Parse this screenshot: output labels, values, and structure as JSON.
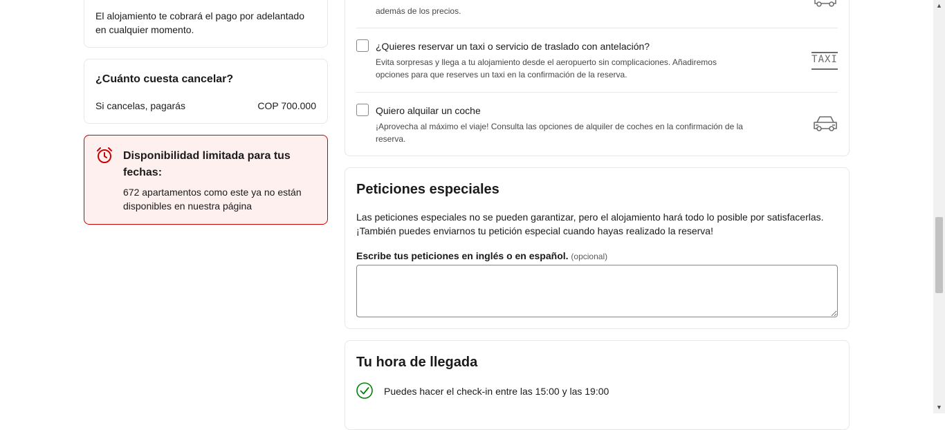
{
  "left": {
    "prepay_text": "El alojamiento te cobrará el pago por adelantado en cualquier momento.",
    "cancel": {
      "title": "¿Cuánto cuesta cancelar?",
      "label": "Si cancelas, pagarás",
      "amount": "COP 700.000"
    },
    "availability": {
      "title": "Disponibilidad limitada para tus fechas:",
      "text": "672 apartamentos como este ya no están disponibles en nuestra página",
      "icon": "alarm-clock-icon"
    }
  },
  "extras": {
    "top_partial_text": "además de los precios.",
    "items": [
      {
        "label": "¿Quieres reservar un taxi o servicio de traslado con antelación?",
        "desc": "Evita sorpresas y llega a tu alojamiento desde el aeropuerto sin complicaciones. Añadiremos opciones para que reserves un taxi en la confirmación de la reserva.",
        "icon": "taxi-icon",
        "icon_text": "TAXI"
      },
      {
        "label": "Quiero alquilar un coche",
        "desc": "¡Aprovecha al máximo el viaje! Consulta las opciones de alquiler de coches en la confirmación de la reserva.",
        "icon": "car-icon"
      }
    ]
  },
  "requests": {
    "title": "Peticiones especiales",
    "desc": "Las peticiones especiales no se pueden garantizar, pero el alojamiento hará todo lo posible por satisfacerlas. ¡También puedes enviarnos tu petición especial cuando hayas realizado la reserva!",
    "field_label": "Escribe tus peticiones en inglés o en español.",
    "optional": "(opcional)",
    "value": ""
  },
  "arrival": {
    "title": "Tu hora de llegada",
    "checkin_text": "Puedes hacer el check-in entre las 15:00 y las 19:00",
    "icon": "check-circle-icon"
  },
  "colors": {
    "accent_red": "#cc0000",
    "alert_bg": "#fff0f0",
    "success_green": "#008009"
  }
}
